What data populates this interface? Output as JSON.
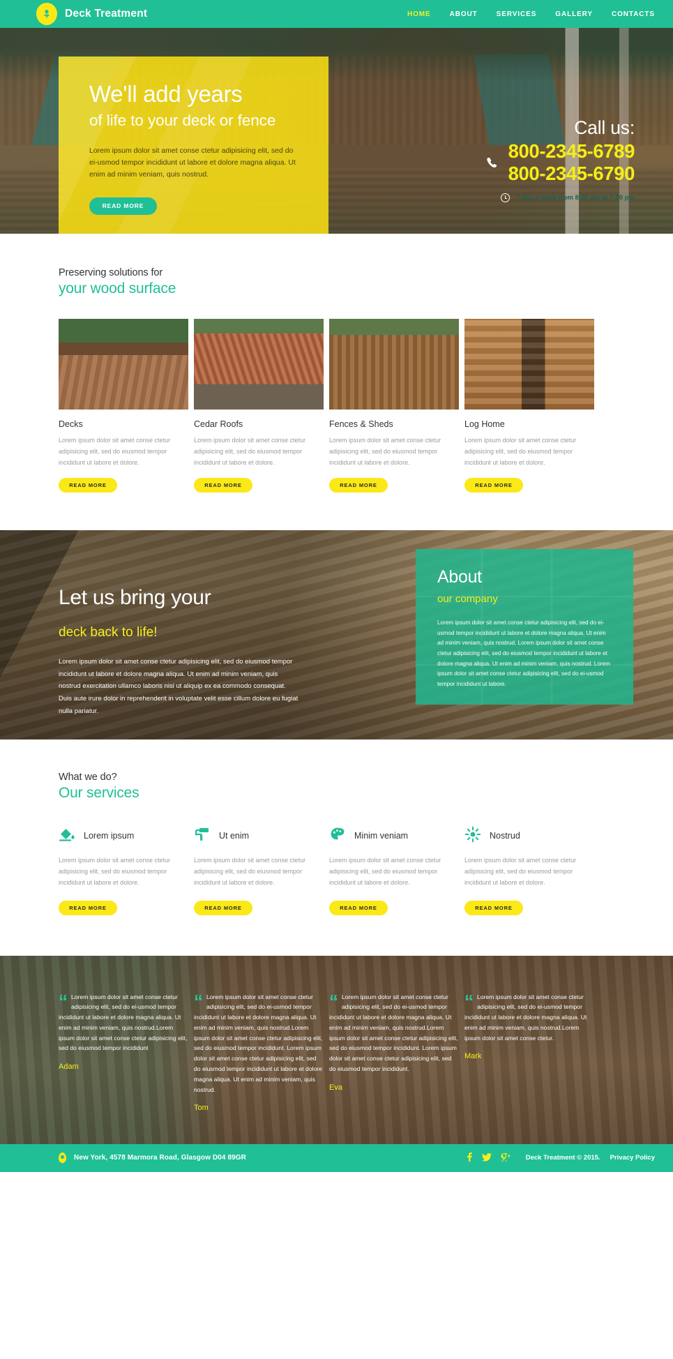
{
  "header": {
    "brand": "Deck Treatment",
    "logo_icon": "leaf-drop-icon",
    "nav": [
      {
        "label": "HOME",
        "active": true
      },
      {
        "label": "ABOUT",
        "active": false
      },
      {
        "label": "SERVICES",
        "active": false
      },
      {
        "label": "GALLERY",
        "active": false
      },
      {
        "label": "CONTACTS",
        "active": false
      }
    ]
  },
  "hero": {
    "heading": "We'll add years",
    "subheading": "of life to your deck or fence",
    "paragraph": "Lorem ipsum dolor sit amet conse ctetur adipisicing elit, sed do ei-usmod tempor incididunt ut labore et dolore magna aliqua. Ut enim ad minim veniam, quis nostrud.",
    "button": "READ MORE",
    "call_title": "Call us:",
    "phone_icon": "phone-icon",
    "phone_1": "800-2345-6789",
    "phone_2": "800-2345-6790",
    "clock_icon": "clock-icon",
    "hours": "7 day a week from 8:00 am  to 7:00 pm"
  },
  "solutions": {
    "sub": "Preserving solutions for",
    "title": "your wood surface",
    "cards": [
      {
        "title": "Decks",
        "text": "Lorem ipsum dolor sit amet conse ctetur adipisicing elit, sed do eiusmod tempor incididunt ut labore et dolore.",
        "button": "READ MORE",
        "image": "deck-photo"
      },
      {
        "title": "Cedar Roofs",
        "text": "Lorem ipsum dolor sit amet conse ctetur adipisicing elit, sed do eiusmod tempor incididunt ut labore et dolore.",
        "button": "READ MORE",
        "image": "cedar-roof-photo"
      },
      {
        "title": "Fences & Sheds",
        "text": "Lorem ipsum dolor sit amet conse ctetur adipisicing elit, sed do eiusmod tempor incididunt ut labore et dolore.",
        "button": "READ MORE",
        "image": "fence-photo"
      },
      {
        "title": "Log Home",
        "text": "Lorem ipsum dolor sit amet conse ctetur adipisicing elit, sed do eiusmod tempor incididunt ut labore et dolore.",
        "button": "READ MORE",
        "image": "log-home-photo"
      }
    ]
  },
  "about": {
    "heading": "Let us bring your",
    "subheading": "deck back to life!",
    "paragraph": "Lorem ipsum dolor sit amet conse ctetur adipisicing elit, sed do eiusmod tempor incididunt ut labore et dolore magna aliqua. Ut enim ad minim veniam, quis nostrud exercitation ullamco laboris nisi ut aliquip ex ea commodo consequat. Duis aute irure dolor in reprehenderit in voluptate velit esse cillum dolore eu fugiat nulla pariatur.",
    "panel_heading": "About",
    "panel_subheading": "our company",
    "panel_paragraph": "Lorem ipsum dolor sit amet conse ctetur adipisicing elit, sed do ei-usmod tempor incididunt ut labore et dolore magna aliqua. Ut enim ad minim veniam, quis nostrud. Lorem ipsum dolor sit amet conse ctetur adipisicing elit, sed do eiusmod tempor incididunt ut labore et dolore magna aliqua. Ut enim ad minim veniam, quis nostrud. Lorem ipsum dolor sit amet conse ctetur adipisicing elit, sed do ei-usmod tempor incididunt ut labore."
  },
  "services": {
    "sub": "What we do?",
    "title": "Our services",
    "items": [
      {
        "name": "Lorem ipsum",
        "icon": "paint-bucket-icon",
        "text": "Lorem ipsum dolor sit amet conse ctetur adipisicing elit, sed do eiusmod tempor incididunt ut labore et dolore.",
        "button": "READ MORE"
      },
      {
        "name": "Ut enim",
        "icon": "paint-roller-icon",
        "text": "Lorem ipsum dolor sit amet conse ctetur adipisicing elit, sed do eiusmod tempor incididunt ut labore et dolore.",
        "button": "READ MORE"
      },
      {
        "name": "Minim veniam",
        "icon": "palette-icon",
        "text": "Lorem ipsum dolor sit amet conse ctetur adipisicing elit, sed do eiusmod tempor incididunt ut labore et dolore.",
        "button": "READ MORE"
      },
      {
        "name": "Nostrud",
        "icon": "sun-icon",
        "text": "Lorem ipsum dolor sit amet conse ctetur adipisicing elit, sed do eiusmod tempor incididunt ut labore et dolore.",
        "button": "READ MORE"
      }
    ]
  },
  "testimonials": [
    {
      "quote_icon": "quote-mark-icon",
      "text": "Lorem ipsum dolor sit amet conse ctetur adipisicing elit, sed do ei-usmod tempor incididunt ut labore et dolore magna aliqua. Ut enim ad minim veniam, quis nostrud.Lorem ipsum dolor sit amet conse ctetur adipisicing elit, sed do eiusmod tempor incididunt",
      "author": "Adam"
    },
    {
      "quote_icon": "quote-mark-icon",
      "text": "Lorem ipsum dolor sit amet conse ctetur adipisicing elit, sed do ei-usmod tempor incididunt ut labore et dolore magna aliqua. Ut enim ad minim veniam, quis nostrud.Lorem ipsum dolor sit amet conse ctetur adipisicing elit, sed do eiusmod tempor incididunt. Lorem ipsum dolor sit amet conse ctetur adipisicing elit, sed do eiusmod tempor incididunt ut labore et dolore magna aliqua. Ut enim ad minim veniam, quis nostrud.",
      "author": "Tom"
    },
    {
      "quote_icon": "quote-mark-icon",
      "text": "Lorem ipsum dolor sit amet conse ctetur adipisicing elit, sed do ei-usmod tempor incididunt ut labore et dolore magna aliqua. Ut enim ad minim veniam, quis nostrud.Lorem ipsum dolor sit amet conse ctetur adipisicing elit, sed do eiusmod tempor incididunt. Lorem ipsum dolor sit amet conse ctetur adipisicing elit, sed do eiusmod tempor incididunt.",
      "author": "Eva"
    },
    {
      "quote_icon": "quote-mark-icon",
      "text": "Lorem ipsum dolor sit amet conse ctetur adipisicing elit, sed do ei-usmod tempor incididunt ut labore et dolore magna aliqua. Ut enim ad minim veniam, quis nostrud.Lorem ipsum dolor sit amet conse ctetur.",
      "author": "Mark"
    }
  ],
  "footer": {
    "pin_icon": "map-pin-icon",
    "address": "New York, 4578 Marmora Road, Glasgow D04 89GR",
    "socials": [
      {
        "icon": "facebook-icon",
        "glyph": "f"
      },
      {
        "icon": "twitter-icon",
        "glyph": "✓"
      },
      {
        "icon": "google-plus-icon",
        "glyph": "g⁺"
      }
    ],
    "copyright": "Deck Treatment © 2015.",
    "privacy": "Privacy Policy"
  },
  "colors": {
    "brand_green": "#20bf96",
    "accent_yellow": "#fbe817",
    "hero_panel_yellow": "#f7de14",
    "muted_text": "#9b9b9b"
  }
}
